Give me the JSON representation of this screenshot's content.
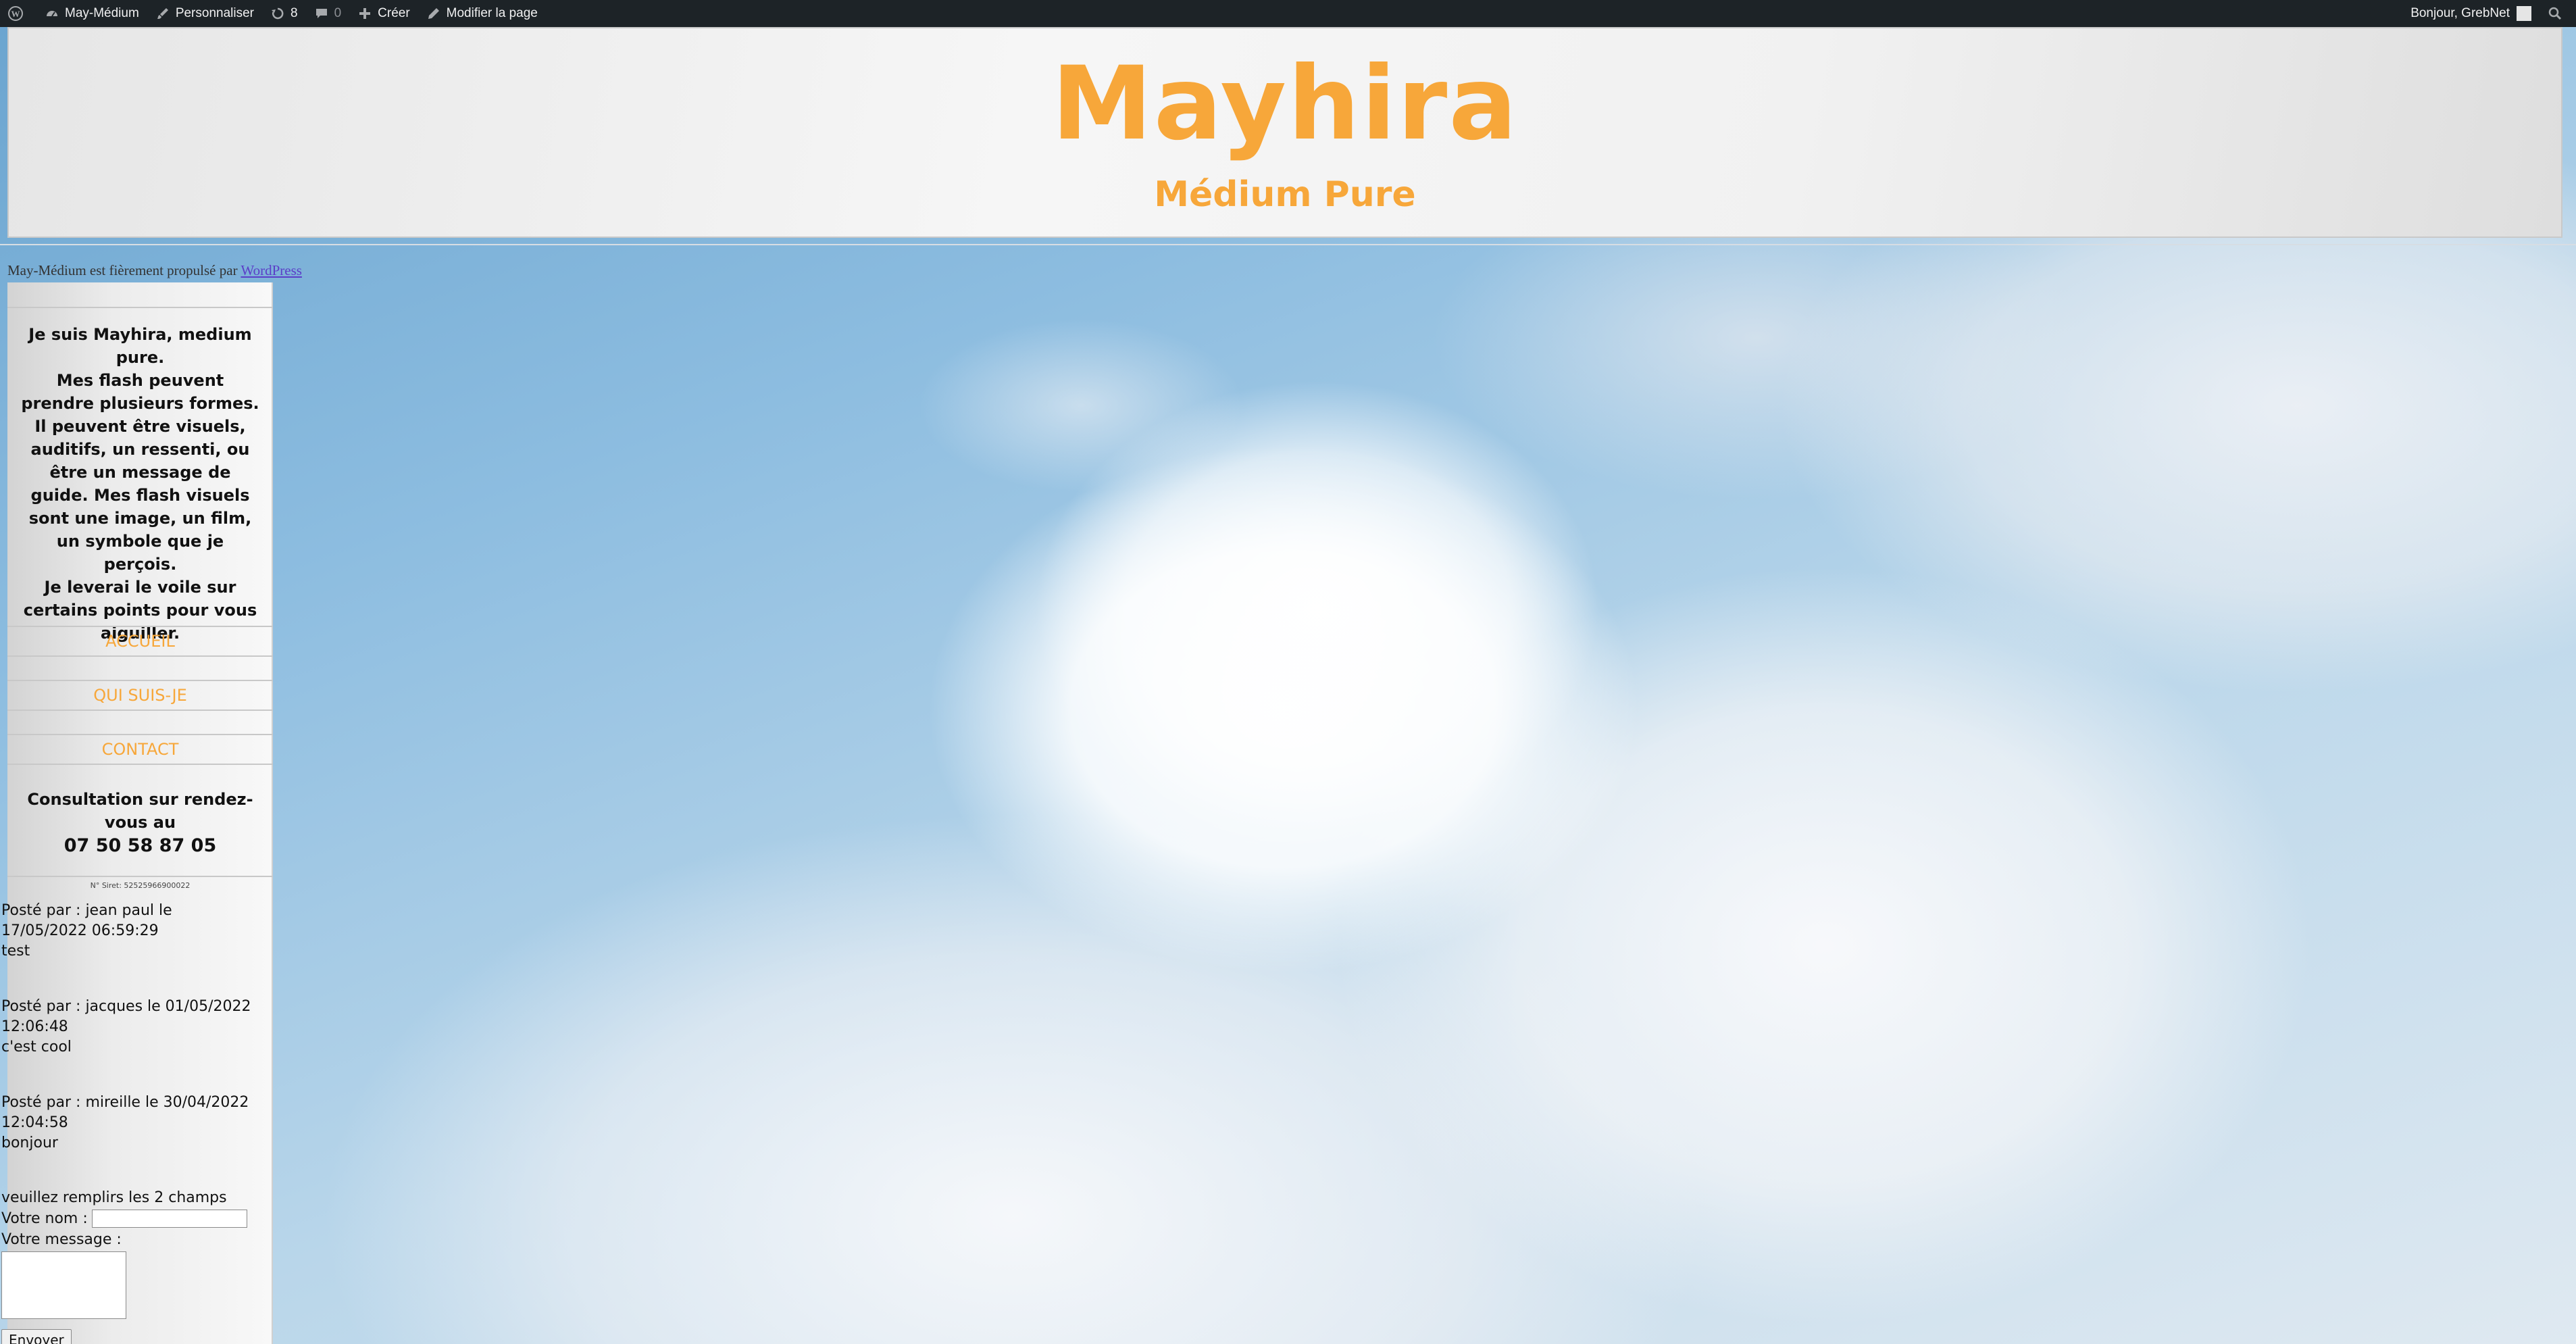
{
  "adminbar": {
    "site_name": "May-Médium",
    "customize": "Personnaliser",
    "updates_count": "8",
    "comments_count": "0",
    "create": "Créer",
    "edit_page": "Modifier la page",
    "greeting": "Bonjour, GrebNet"
  },
  "header": {
    "title": "Mayhira",
    "subtitle": "Médium Pure"
  },
  "powered": {
    "text": "May-Médium est fièrement propulsé par ",
    "link": "WordPress"
  },
  "sidebar": {
    "bio": [
      "Je suis Mayhira, medium pure.",
      "Mes flash peuvent prendre plusieurs formes. Il peuvent être visuels, auditifs, un ressenti, ou être un message de guide. Mes flash visuels sont une image, un film, un symbole que je perçois.",
      "Je leverai le voile sur certains points pour vous aiguiller."
    ],
    "menu": [
      "ACCUEIL",
      "QUI SUIS-JE",
      "CONTACT"
    ],
    "consult_text": "Consultation sur rendez-vous au",
    "phone": "07 50 58 87 05",
    "siret": "N° Siret: 52525966900022"
  },
  "comments": [
    {
      "meta": "Posté par : jean paul le 17/05/2022 06:59:29",
      "text": "test"
    },
    {
      "meta": "Posté par : jacques le 01/05/2022 12:06:48",
      "text": "c'est cool"
    },
    {
      "meta": "Posté par : mireille le 30/04/2022 12:04:58",
      "text": "bonjour"
    }
  ],
  "form": {
    "instruction": "veuillez remplirs les 2 champs",
    "name_label": "Votre nom :",
    "message_label": "Votre message :",
    "send": "Envoyer"
  },
  "colors": {
    "accent": "#f7a73a",
    "adminbar": "#1d2327"
  }
}
